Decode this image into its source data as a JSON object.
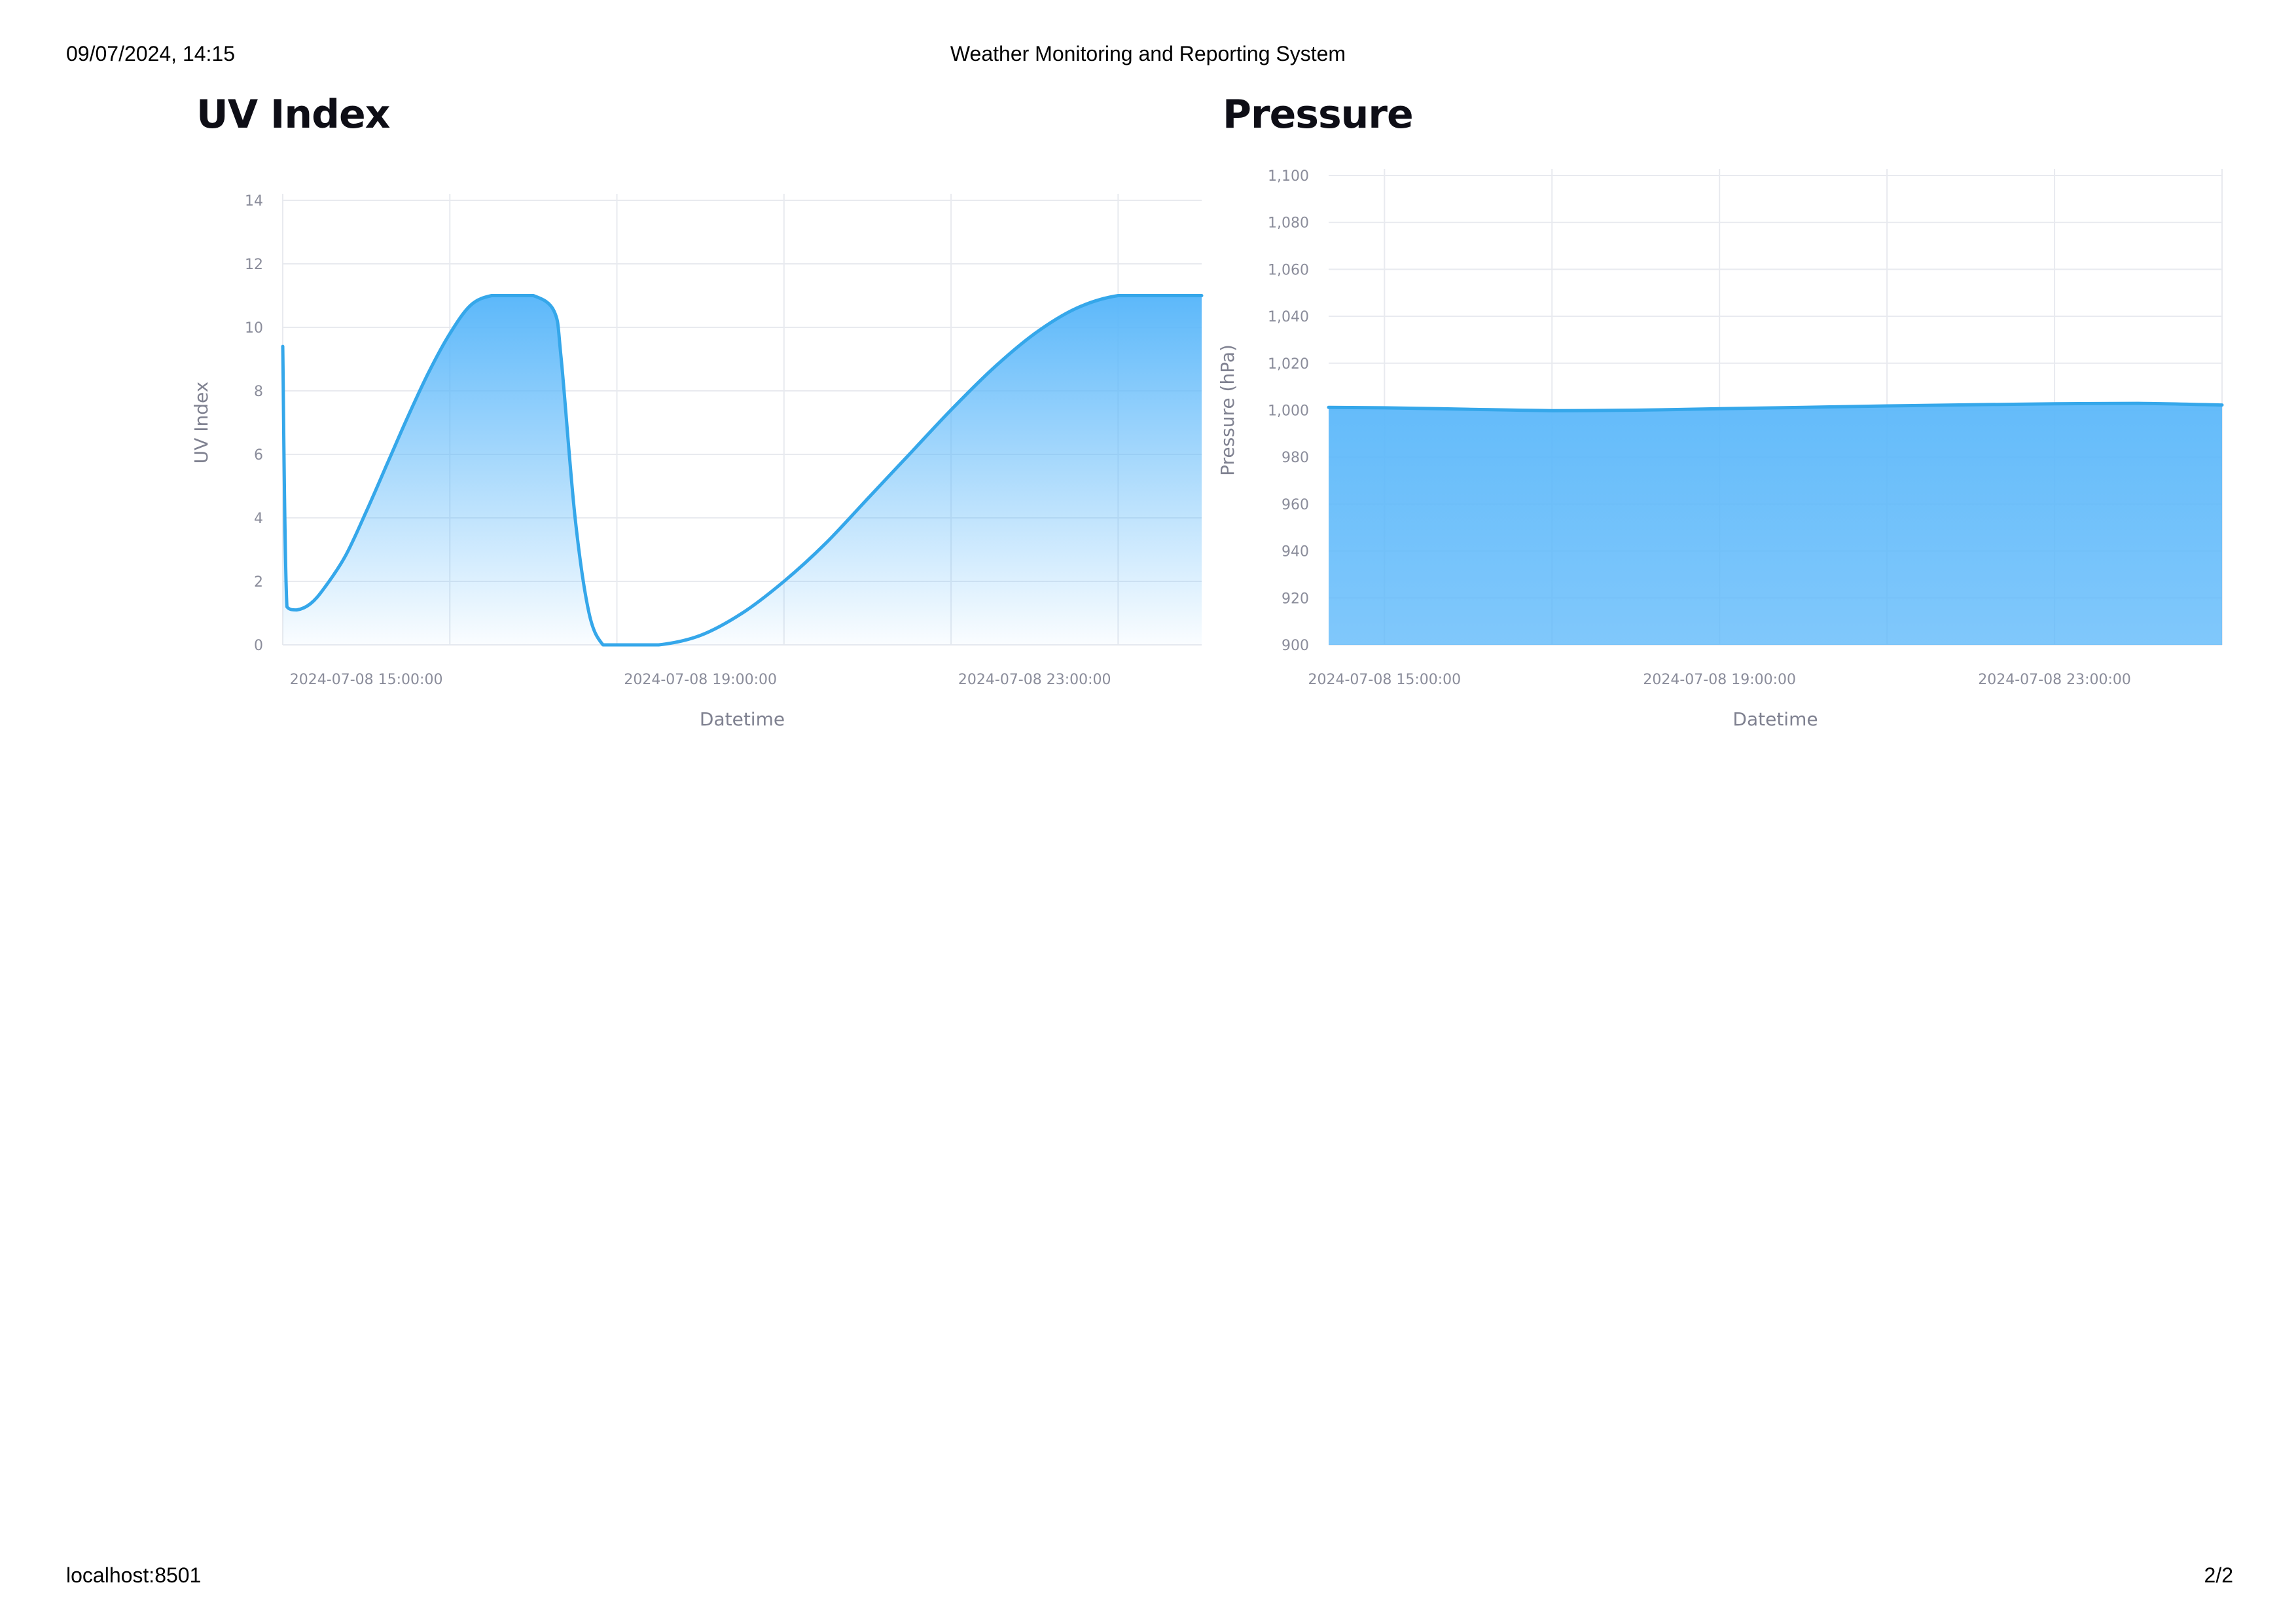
{
  "print_header": {
    "datetime": "09/07/2024, 14:15",
    "title": "Weather Monitoring and Reporting System"
  },
  "print_footer": {
    "url": "localhost:8501",
    "page": "2/2"
  },
  "colors": {
    "series_line": "#35a7ea",
    "area_fill": "#5cb8fa",
    "gridline": "#e8eaef",
    "tick_text": "#8a8c9a"
  },
  "uv_chart": {
    "title": "UV Index"
  },
  "pressure_chart": {
    "title": "Pressure"
  },
  "chart_data": [
    {
      "type": "area",
      "title": "UV Index",
      "xlabel": "Datetime",
      "ylabel": "UV Index",
      "xlim": [
        "2024-07-08 14:00:00",
        "2024-07-09 01:00:00"
      ],
      "ylim": [
        0,
        14
      ],
      "x_ticks": [
        "2024-07-08 15:00:00",
        "2024-07-08 19:00:00",
        "2024-07-08 23:00:00"
      ],
      "y_ticks": [
        0,
        2,
        4,
        6,
        8,
        10,
        12,
        14
      ],
      "grid": true,
      "fill": "gradient",
      "x": [
        "2024-07-08 14:00:00",
        "2024-07-08 14:03:00",
        "2024-07-08 14:10:00",
        "2024-07-08 14:20:00",
        "2024-07-08 14:30:00",
        "2024-07-08 14:45:00",
        "2024-07-08 15:00:00",
        "2024-07-08 15:15:00",
        "2024-07-08 15:30:00",
        "2024-07-08 15:45:00",
        "2024-07-08 16:00:00",
        "2024-07-08 16:15:00",
        "2024-07-08 16:30:00",
        "2024-07-08 16:45:00",
        "2024-07-08 17:00:00",
        "2024-07-08 17:15:00",
        "2024-07-08 17:20:00",
        "2024-07-08 17:30:00",
        "2024-07-08 17:40:00",
        "2024-07-08 17:50:00",
        "2024-07-08 17:58:00",
        "2024-07-08 18:00:00",
        "2024-07-08 18:30:00",
        "2024-07-08 19:00:00",
        "2024-07-08 19:30:00",
        "2024-07-08 20:00:00",
        "2024-07-08 20:30:00",
        "2024-07-08 21:00:00",
        "2024-07-08 21:30:00",
        "2024-07-08 22:00:00",
        "2024-07-08 22:30:00",
        "2024-07-08 23:00:00",
        "2024-07-08 23:30:00",
        "2024-07-09 00:00:00",
        "2024-07-09 00:30:00",
        "2024-07-09 01:00:00"
      ],
      "series": [
        {
          "values": [
            9.4,
            1.2,
            1.1,
            1.3,
            1.8,
            2.8,
            4.2,
            5.7,
            7.2,
            8.6,
            9.8,
            10.7,
            11.0,
            11.0,
            11.0,
            10.5,
            9.0,
            4.0,
            1.0,
            0.0,
            0.0,
            0.0,
            0.0,
            0.3,
            1.0,
            2.0,
            3.2,
            4.6,
            6.0,
            7.4,
            8.7,
            9.8,
            10.6,
            11.0,
            11.0,
            11.0
          ]
        }
      ]
    },
    {
      "type": "area",
      "title": "Pressure",
      "xlabel": "Datetime",
      "ylabel": "Pressure (hPa)",
      "xlim": [
        "2024-07-08 14:20:00",
        "2024-07-09 01:00:00"
      ],
      "ylim": [
        900,
        1100
      ],
      "x_ticks": [
        "2024-07-08 15:00:00",
        "2024-07-08 19:00:00",
        "2024-07-08 23:00:00"
      ],
      "y_ticks": [
        "900",
        "920",
        "940",
        "960",
        "980",
        "1,000",
        "1,020",
        "1,040",
        "1,060",
        "1,080",
        "1,100"
      ],
      "grid": true,
      "fill": "solid",
      "x": [
        "2024-07-08 14:20:00",
        "2024-07-08 15:00:00",
        "2024-07-08 16:00:00",
        "2024-07-08 17:00:00",
        "2024-07-08 18:00:00",
        "2024-07-08 19:00:00",
        "2024-07-08 20:00:00",
        "2024-07-08 21:00:00",
        "2024-07-08 22:00:00",
        "2024-07-08 23:00:00",
        "2024-07-09 00:00:00",
        "2024-07-09 01:00:00"
      ],
      "series": [
        {
          "values": [
            1001.2,
            1001.0,
            1000.4,
            999.8,
            1000.0,
            1000.6,
            1001.2,
            1001.8,
            1002.3,
            1002.7,
            1002.9,
            1002.2
          ]
        }
      ]
    }
  ]
}
